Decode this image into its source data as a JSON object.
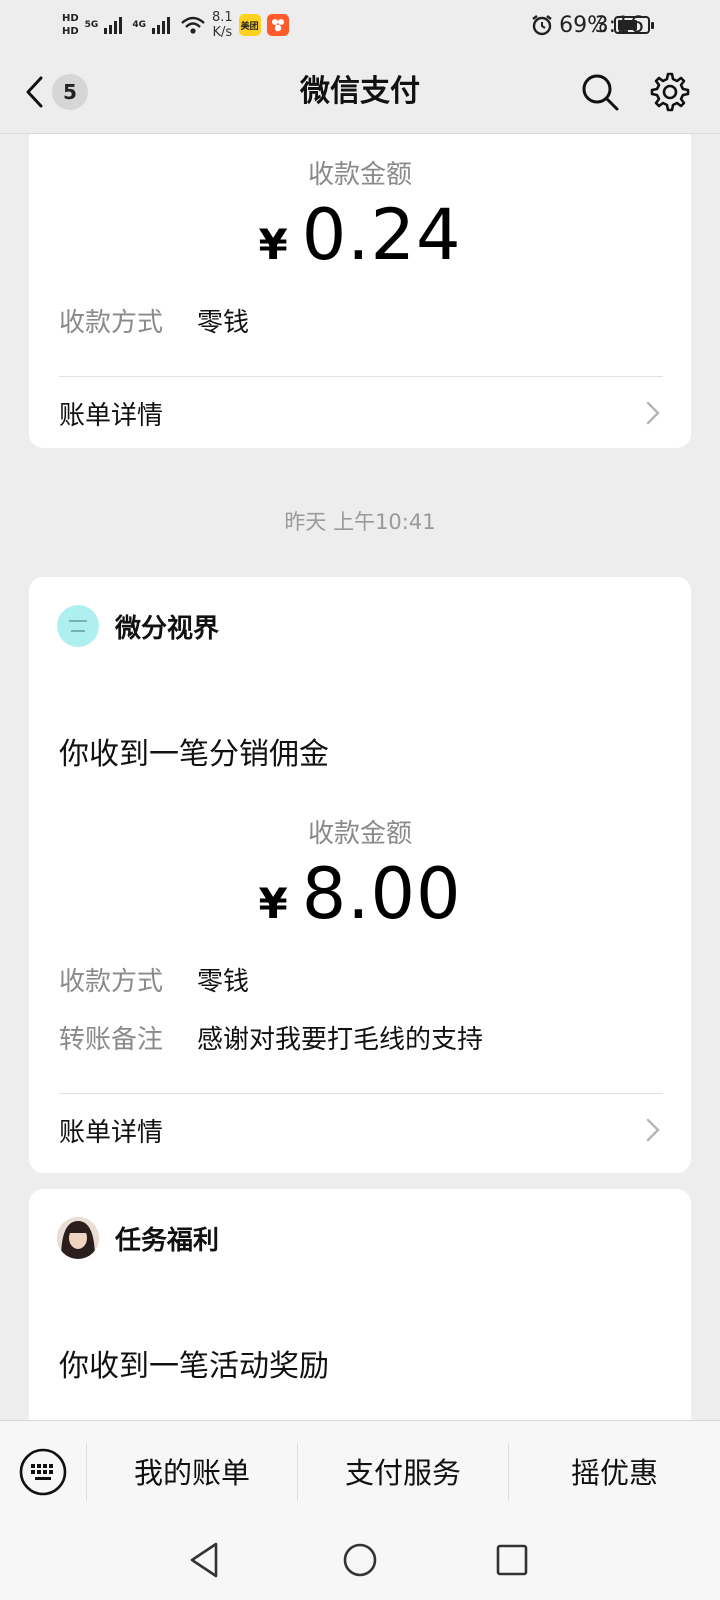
{
  "status_bar": {
    "hd1": "HD",
    "hd2": "HD",
    "net1": "5G",
    "net2": "4G",
    "speed_value": "8.1",
    "speed_unit": "K/s",
    "app1": "美团",
    "app2": "",
    "battery": "69%",
    "battery_level": 0.69,
    "time": "3:16"
  },
  "nav": {
    "badge": "5",
    "title": "微信支付",
    "icons": [
      "back-icon",
      "search-icon",
      "settings-icon"
    ]
  },
  "card1": {
    "amount_label": "收款金额",
    "currency": "¥",
    "amount": "0.24",
    "method_key": "收款方式",
    "method_val": "零钱",
    "detail": "账单详情"
  },
  "timestamp": "昨天 上午10:41",
  "card2": {
    "merchant": "微分视界",
    "message": "你收到一笔分销佣金",
    "amount_label": "收款金额",
    "currency": "¥",
    "amount": "8.00",
    "method_key": "收款方式",
    "method_val": "零钱",
    "note_key": "转账备注",
    "note_val": "感谢对我要打毛线的支持",
    "detail": "账单详情"
  },
  "card3": {
    "merchant": "任务福利",
    "message": "你收到一笔活动奖励"
  },
  "bottom_menu": {
    "items": [
      "我的账单",
      "支付服务",
      "摇优惠"
    ]
  },
  "colors": {
    "background": "#ededed",
    "card": "#ffffff",
    "secondary_text": "#8a8a8a",
    "avatar1": "#aef0ef"
  }
}
